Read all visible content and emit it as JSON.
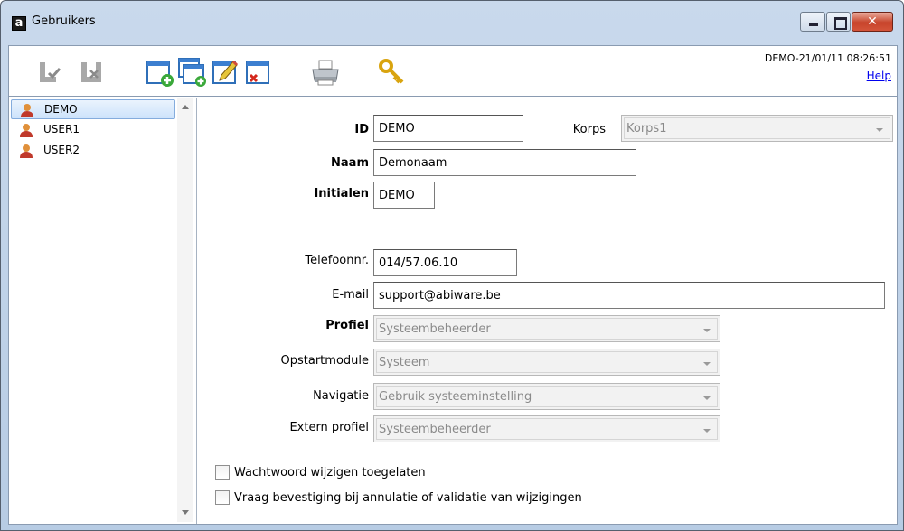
{
  "window": {
    "title": "Gebruikers",
    "app_icon_letter": "a",
    "close_glyph": "✕"
  },
  "toolbar": {
    "buttons": [
      {
        "icon": "save-disabled-icon"
      },
      {
        "icon": "cancel-disabled-icon"
      },
      {
        "icon": "new-record-icon"
      },
      {
        "icon": "copy-record-icon"
      },
      {
        "icon": "edit-record-icon"
      },
      {
        "icon": "delete-record-icon"
      },
      {
        "icon": "print-icon"
      },
      {
        "icon": "key-icon"
      }
    ],
    "stamp": "DEMO-21/01/11 08:26:51",
    "help_label": "Help"
  },
  "users": [
    {
      "name": "DEMO",
      "selected": true
    },
    {
      "name": "USER1",
      "selected": false
    },
    {
      "name": "USER2",
      "selected": false
    }
  ],
  "form": {
    "id_label": "ID",
    "id_value": "DEMO",
    "korps_label": "Korps",
    "korps_value": "Korps1",
    "naam_label": "Naam",
    "naam_value": "Demonaam",
    "initialen_label": "Initialen",
    "initialen_value": "DEMO",
    "telefoon_label": "Telefoonnr.",
    "telefoon_value": "014/57.06.10",
    "email_label": "E-mail",
    "email_value": "support@abiware.be",
    "profiel_label": "Profiel",
    "profiel_value": "Systeembeheerder",
    "opstart_label": "Opstartmodule",
    "opstart_value": "Systeem",
    "navigatie_label": "Navigatie",
    "navigatie_value": "Gebruik systeeminstelling",
    "extern_label": "Extern profiel",
    "extern_value": "Systeembeheerder",
    "chk_wachtwoord_label": "Wachtwoord wijzigen toegelaten",
    "chk_wachtwoord_checked": false,
    "chk_bevestiging_label": "Vraag bevestiging bij annulatie of validatie van wijzigingen",
    "chk_bevestiging_checked": false
  },
  "colors": {
    "accent": "#3c7fd0",
    "selection": "#cde3fb",
    "close_red": "#c7442b"
  }
}
